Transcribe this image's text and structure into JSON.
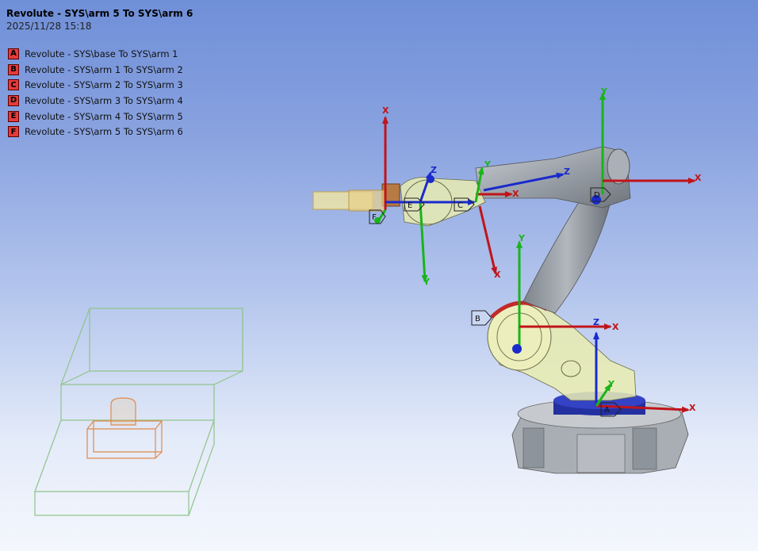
{
  "header": {
    "title": "Revolute - SYS\\arm 5 To SYS\\arm 6",
    "datetime": "2025/11/28 15:18"
  },
  "legend": [
    {
      "tag": "A",
      "label": "Revolute - SYS\\base To SYS\\arm 1"
    },
    {
      "tag": "B",
      "label": "Revolute - SYS\\arm 1 To SYS\\arm 2"
    },
    {
      "tag": "C",
      "label": "Revolute - SYS\\arm 2 To SYS\\arm 3"
    },
    {
      "tag": "D",
      "label": "Revolute - SYS\\arm 3 To SYS\\arm 4"
    },
    {
      "tag": "E",
      "label": "Revolute - SYS\\arm 4 To SYS\\arm 5"
    },
    {
      "tag": "F",
      "label": "Revolute - SYS\\arm 5 To SYS\\arm 6"
    }
  ],
  "triads": {
    "axis_x": "X",
    "axis_y": "Y",
    "axis_z": "Z"
  },
  "joint_markers": {
    "a": "A",
    "b": "B",
    "c": "C",
    "d": "D",
    "e": "E",
    "f": "F"
  },
  "colors": {
    "x_axis": "#c0141a",
    "y_axis": "#1ab41a",
    "z_axis": "#1a2acc",
    "tag_fill": "#e53b3b",
    "highlight": "#e9ecb0",
    "robot_gray": "#8d939b"
  }
}
